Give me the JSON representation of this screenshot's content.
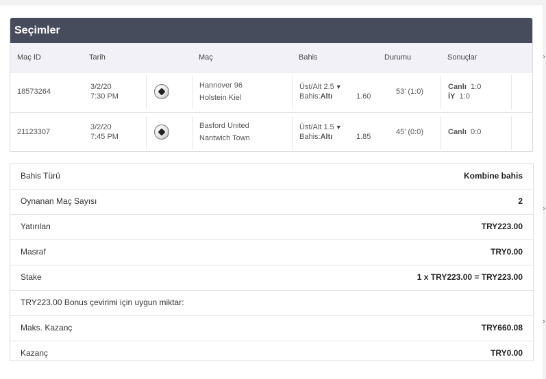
{
  "selections": {
    "title": "Seçimler",
    "columns": {
      "match_id": "Maç ID",
      "date": "Tarih",
      "match": "Maç",
      "bet": "Bahis",
      "status": "Durumu",
      "results": "Sonuçlar"
    },
    "rows": [
      {
        "id": "18573264",
        "date": "3/2/20",
        "time": "7:30 PM",
        "home": "Hannover 96",
        "away": "Holstein Kiel",
        "market": "Üst/Alt 2.5",
        "bet_label": "Bahis:",
        "bet_value": "Altı",
        "odds": "1.60",
        "status": "53' (1:0)",
        "result1_label": "Canlı",
        "result1_value": "1:0",
        "result2_label": "İY",
        "result2_value": "1:0"
      },
      {
        "id": "21123307",
        "date": "3/2/20",
        "time": "7:45 PM",
        "home": "Basford United",
        "away": "Nantwich Town",
        "market": "Üst/Alt 1.5",
        "bet_label": "Bahis:",
        "bet_value": "Altı",
        "odds": "1.85",
        "status": "45' (0:0)",
        "result1_label": "Canlı",
        "result1_value": "0:0"
      }
    ]
  },
  "summary": {
    "rows": [
      {
        "label": "Bahis Türü",
        "value": "Kombine bahis"
      },
      {
        "label": "Oynanan Maç Sayısı",
        "value": "2"
      },
      {
        "label": "Yatırılan",
        "value": "TRY223.00"
      },
      {
        "label": "Masraf",
        "value": "TRY0.00"
      },
      {
        "label": "Stake",
        "value": "1 x TRY223.00 = TRY223.00"
      },
      {
        "label": "TRY223.00 Bonus çevirimi için uygun miktar:",
        "value": ""
      },
      {
        "label": "Maks. Kazanç",
        "value": "TRY660.08"
      },
      {
        "label": "Kazanç",
        "value": "TRY0.00"
      }
    ]
  },
  "icons": {
    "sport": "soccer-ball-icon",
    "dropdown": "caret-down-icon"
  },
  "colors": {
    "header_bg": "#474c5c",
    "column_head_bg": "#f1f1f7",
    "page_bg": "#f2f2f2"
  }
}
